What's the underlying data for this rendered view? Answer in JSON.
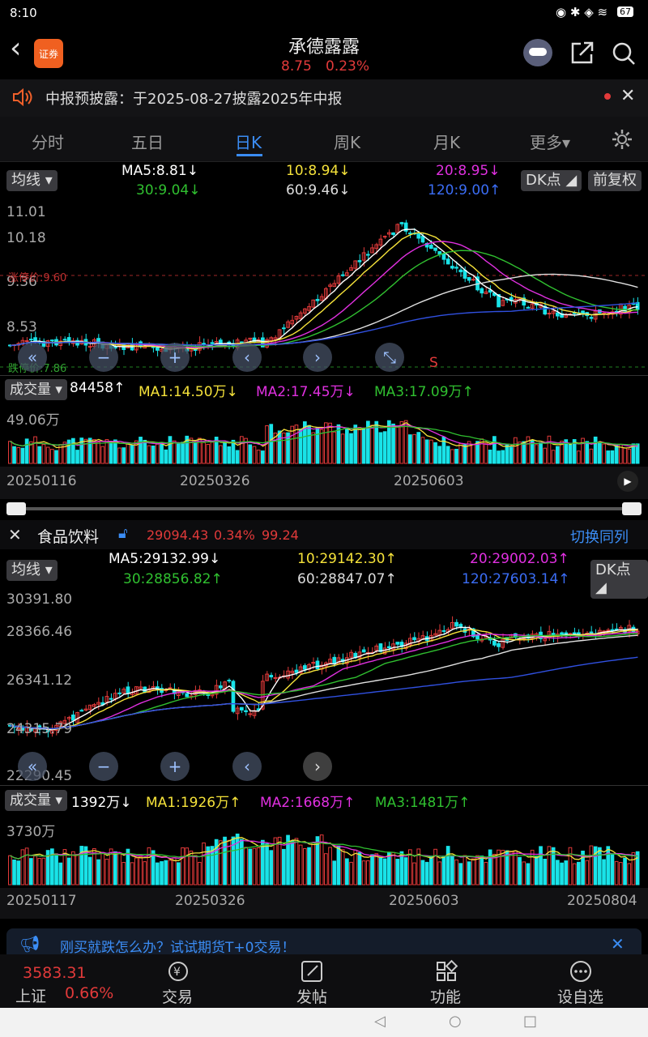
{
  "status_bar": {
    "time": "8:10",
    "battery": "67"
  },
  "header": {
    "title": "承德露露",
    "price": "8.75",
    "change_pct": "0.23%",
    "logo_text": "证券"
  },
  "notice": {
    "text": "中报预披露：于2025-08-27披露2025年中报"
  },
  "tabs": [
    "分时",
    "五日",
    "日K",
    "周K",
    "月K",
    "更多▾"
  ],
  "active_tab": 2,
  "stock_chart": {
    "ma_selector": "均线",
    "ma5": "MA5:8.81↓",
    "ma10": "10:8.94↓",
    "ma20": "20:8.95↓",
    "ma30": "30:9.04↓",
    "ma60": "60:9.46↓",
    "ma120": "120:9.00↑",
    "dk_button": "DK点",
    "fq_button": "前复权",
    "y_labels": [
      "11.01",
      "10.18",
      "9.36",
      "8.53"
    ],
    "limit_up": "涨停价:9.60",
    "limit_down": "跌停价:7.86",
    "s_marker": "S"
  },
  "stock_volume": {
    "selector": "成交量",
    "value": "84458↑",
    "ma1": "MA1:14.50万↓",
    "ma2": "MA2:17.45万↓",
    "ma3": "MA3:17.09万↑",
    "max_label": "49.06万",
    "dates": [
      "20250116",
      "20250326",
      "20250603"
    ]
  },
  "sector": {
    "name": "食品饮料",
    "value": "29094.43",
    "pct": "0.34%",
    "change": "99.24",
    "switch": "切换同列"
  },
  "sector_chart": {
    "ma_selector": "均线",
    "ma5": "MA5:29132.99↓",
    "ma10": "10:29142.30↑",
    "ma20": "20:29002.03↑",
    "ma30": "30:28856.82↑",
    "ma60": "60:28847.07↑",
    "ma120": "120:27603.14↑",
    "dk_button": "DK点",
    "y_labels": [
      "30391.80",
      "28366.46",
      "26341.12",
      "24315.79",
      "22290.45"
    ]
  },
  "sector_volume": {
    "selector": "成交量",
    "value": "1392万↓",
    "ma1": "MA1:1926万↑",
    "ma2": "MA2:1668万↑",
    "ma3": "MA3:1481万↑",
    "max_label": "3730万",
    "dates": [
      "20250117",
      "20250326",
      "20250603",
      "20250804"
    ]
  },
  "ad": {
    "text": "刚买就跌怎么办？试试期货T+0交易！"
  },
  "bottom": {
    "index_value": "3583.31",
    "index_name": "上证",
    "index_pct": "0.66%",
    "items": [
      "交易",
      "发帖",
      "功能",
      "设自选"
    ]
  },
  "colors": {
    "up": "#e23a3a",
    "down": "#19e3e8",
    "ma5": "#ffffff",
    "ma10": "#f5e23a",
    "ma20": "#e030e0",
    "ma30": "#30c030",
    "ma60": "#e0e0e0",
    "ma120": "#3050e0",
    "accent": "#3b8df5"
  }
}
